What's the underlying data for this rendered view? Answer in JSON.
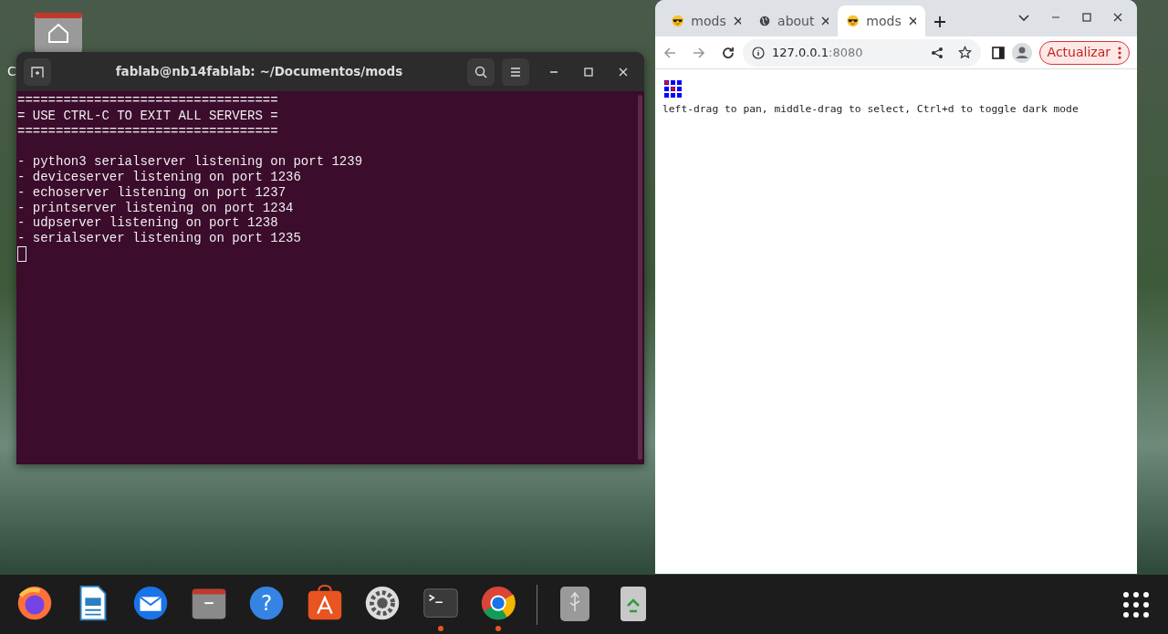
{
  "desktop": {
    "icon_label": "C"
  },
  "terminal": {
    "title": "fablab@nb14fablab: ~/Documentos/mods",
    "banner": [
      "==================================",
      "= USE CTRL-C TO EXIT ALL SERVERS =",
      "=================================="
    ],
    "lines": [
      "- python3 serialserver listening on port 1239",
      "- deviceserver listening on port 1236",
      "- echoserver listening on port 1237",
      "- printserver listening on port 1234",
      "- udpserver listening on port 1238",
      "- serialserver listening on port 1235"
    ]
  },
  "browser": {
    "tabs": [
      {
        "label": "mods",
        "kind": "emoji",
        "selected": false
      },
      {
        "label": "about",
        "kind": "globe",
        "selected": false
      },
      {
        "label": "mods",
        "kind": "emoji",
        "selected": true
      }
    ],
    "url_host": "127.0.0.1",
    "url_port": ":8080",
    "update_button": "Actualizar",
    "page_text": "left-drag to pan, middle-drag to select, Ctrl+d to toggle dark mode"
  },
  "dock": {
    "items": [
      {
        "kind": "firefox",
        "running": false
      },
      {
        "kind": "writer",
        "running": false
      },
      {
        "kind": "mail",
        "running": false
      },
      {
        "kind": "files",
        "running": false
      },
      {
        "kind": "help",
        "glyph": "?",
        "running": false
      },
      {
        "kind": "store",
        "running": false
      },
      {
        "kind": "settings",
        "running": false
      },
      {
        "kind": "terminal",
        "running": true
      },
      {
        "kind": "chrome",
        "running": true
      }
    ],
    "devices": [
      {
        "kind": "usb"
      },
      {
        "kind": "trash"
      }
    ]
  }
}
